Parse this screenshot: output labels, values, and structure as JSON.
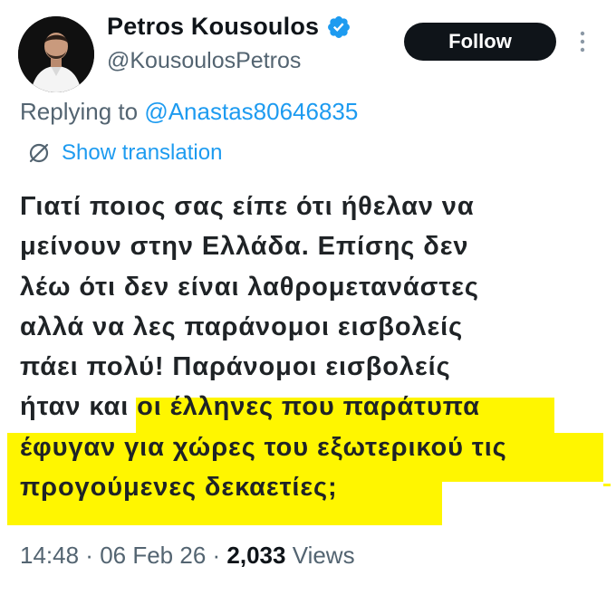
{
  "tweet": {
    "author_name": "Petros Kousoulos",
    "author_handle": "@KousoulosPetros",
    "follow_label": "Follow",
    "reply_prefix": "Replying to ",
    "reply_mention": "@Anastas80646835",
    "show_translation_label": "Show translation",
    "text": "Γιατί ποιος σας είπε ότι ήθελαν να\nμείνουν στην Ελλάδα. Επίσης δεν\nλέω ότι δεν είναι λαθρομετανάστες\nαλλά να λες παράνομοι εισβολείς\nπάει πολύ! Παράνομοι εισβολείς\nήταν και οι έλληνες που παράτυπα\nέφυγαν για χώρες του εξωτερικού τις\nπρογούμενες δεκαετίες;",
    "time": "14:48",
    "date": "06 Feb 26",
    "views_count": "2,033",
    "views_label": "Views",
    "separator": " · "
  },
  "colors": {
    "accent": "#1d9bf0",
    "highlight": "#fff600",
    "secondary_text": "#536471",
    "primary_text": "#0f1419"
  },
  "icons": {
    "verified": "verified-badge-icon",
    "more": "more-vertical-icon",
    "translate": "translate-icon"
  }
}
